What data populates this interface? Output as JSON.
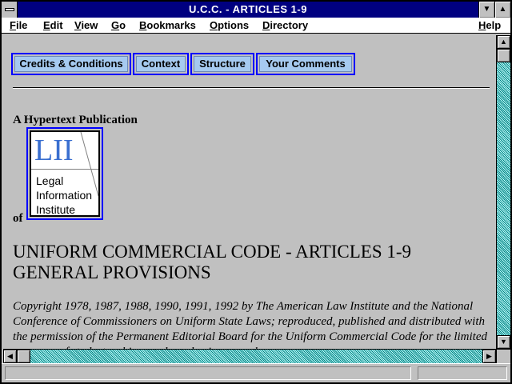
{
  "window": {
    "title": "U.C.C. - ARTICLES 1-9"
  },
  "menu": [
    "File",
    "Edit",
    "View",
    "Go",
    "Bookmarks",
    "Options",
    "Directory",
    "Help"
  ],
  "nav_buttons": [
    "Credits & Conditions",
    "Context",
    "Structure",
    "Your Comments"
  ],
  "content": {
    "hypertext_label": "A Hypertext Publication",
    "of_label": "of",
    "logo": {
      "letters": "LII",
      "lines": [
        "Legal",
        "Information",
        "Institute"
      ]
    },
    "heading_line1": "UNIFORM COMMERCIAL CODE - ARTICLES 1-9",
    "heading_line2": "GENERAL PROVISIONS",
    "copyright": "Copyright 1978, 1987, 1988, 1990, 1991, 1992 by The American Law Institute and the National Conference of Commissioners on Uniform State Laws; reproduced, published and distributed with the permission of the Permanent Editorial Board for the Uniform Commercial Code for the limited purposes of study, teaching, and academic research."
  },
  "colors": {
    "titlebar": "#000080",
    "nav_button_fill": "#a6caf0",
    "link_border": "#0000ff",
    "logo_letters": "#3a6fd0"
  },
  "icons": {
    "scroll_up": "▲",
    "scroll_down": "▼",
    "scroll_left": "◀",
    "scroll_right": "▶",
    "minimize": "▼",
    "maximize": "▲"
  }
}
